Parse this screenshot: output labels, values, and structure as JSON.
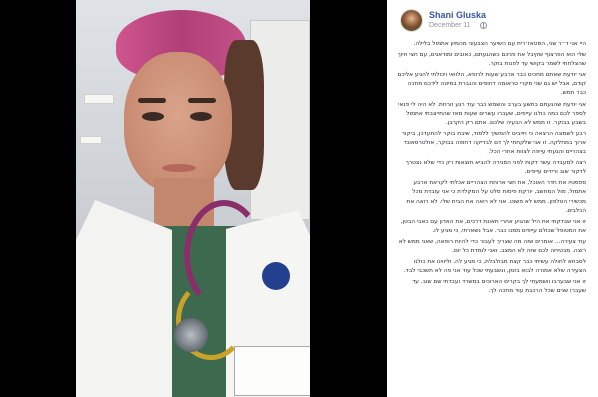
{
  "photo": {
    "alt": "Selfie of a doctor with pink hair wearing a white coat and stethoscope"
  },
  "post": {
    "author": "Shani Gluska",
    "date": "December 11",
    "privacy_icon": "globe-icon",
    "author_color": "#365899",
    "paragraphs": [
      "היי אני ד״ר שני, הסטאז׳רית עם השיער הצבעוני מהמיון אתמול בלילה.",
      "שלי הוא הפרצוף שקיבל את פניכם כשהגעתם, כאובים ומודאגים, עם חצי חיוך שהצלחתי לשמר בקושי עד לפנות בוקר.",
      "אני יודעת שאתם מחכים כבר ארבע שעות לרופא, הלוואי ויכולתי להגיע אליכם קודם, אבל יש גם שני מקרי טראומה דחופים והגברת במיטה לידכם מחכה כבר חמש.",
      "אני יודעת שהגעתם בתשע בערב והשמש כבר עוד רגע זורחת. לא היה לי פנאי לספר לכם כמה כולנו עייפים, שעברו עשרים שעות מאז שהתייצבתי אתמול בשבע בבוקר. זו ממש לא הבעיה שלכם. אתם רק הקרבן.",
      "רבע לשמונה הרצאה כי חייבים להמשיך ללמוד, שיבת בוקר להתעדכן, ביקור ארוך במחלקה. זו אני שלקחתי לך דם לבדיקה דחופה בבוקר, אולטרסאונד בצהריים והגעתי עייפה לצוות אחרי הכל.",
      "רצה למעבדה עשר דקות לפני הסגירה להביא תוצאות רק כדי שלא נצטרך לדקור שוב ורידים עייפים.",
      "ספסטיו את חדר האוכל, את חצי ארוחת הצהריים אכלתי לקראת ארבע אתמול. מול המחשב, יורקת פיסות סלט על המקלדת כי אני עובדת מכל מכשירי הטלפון. ממש לא פשוט. אני לא רואה את הבית שלי. לא רואה את הכלבים.",
      "זו אני שבדקתי את היל שהגיע אחרי תאונת דרכים, את האדון עם כאבי הבטן, את המטופל שכולם עייפים ממנו כבר. אבל נשארתי, כי מגיע לו.",
      "עוד צעירה... אומרים שזה מה שצריך לעבור כדי להיות רופאה, שאני ממש לא רוצה. מבטיחה לכם שזה לא המצב. ואני לומדת כל יום.",
      "לסבתא לחולה עשיתי כבר קצת מבולבלת, כי מגיע לה. וליווינו את כולנו הצעירה שלא אמורה לבוא בזמן, ונשבעתי שכל עוד אני פה לא תשכבי לבד.",
      "זו אני שבערבו וושמעתי לך בקרים הארוכים במשרד ועבדתי שם שוב. עד שעברו שנים שכל הרכבת עוד מחכה לך."
    ]
  }
}
